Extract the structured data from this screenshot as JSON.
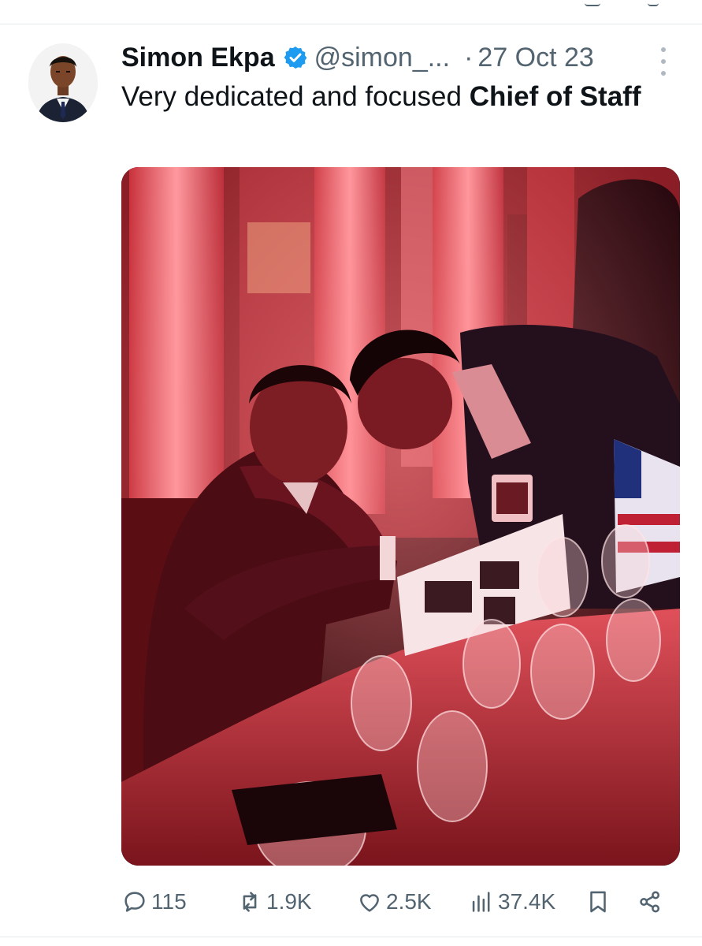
{
  "tweet": {
    "author_name": "Simon Ekpa",
    "author_handle": "@simon_...",
    "separator": "·",
    "date": "27 Oct 23",
    "text_plain": "Very dedicated and focused ",
    "text_bold": "Chief of Staff"
  },
  "actions": {
    "replies": "115",
    "reposts": "1.9K",
    "likes": "2.5K",
    "views": "37.4K"
  },
  "icons": {
    "avatar": "avatar",
    "verified": "verified-badge-icon",
    "more": "more-options-icon",
    "reply": "reply-icon",
    "repost": "repost-icon",
    "like": "heart-icon",
    "views": "views-chart-icon",
    "bookmark": "bookmark-icon",
    "share": "share-icon"
  },
  "colors": {
    "text": "#0f1419",
    "muted": "#536471",
    "verified": "#1d9bf0",
    "divider": "#e6e9ec"
  }
}
